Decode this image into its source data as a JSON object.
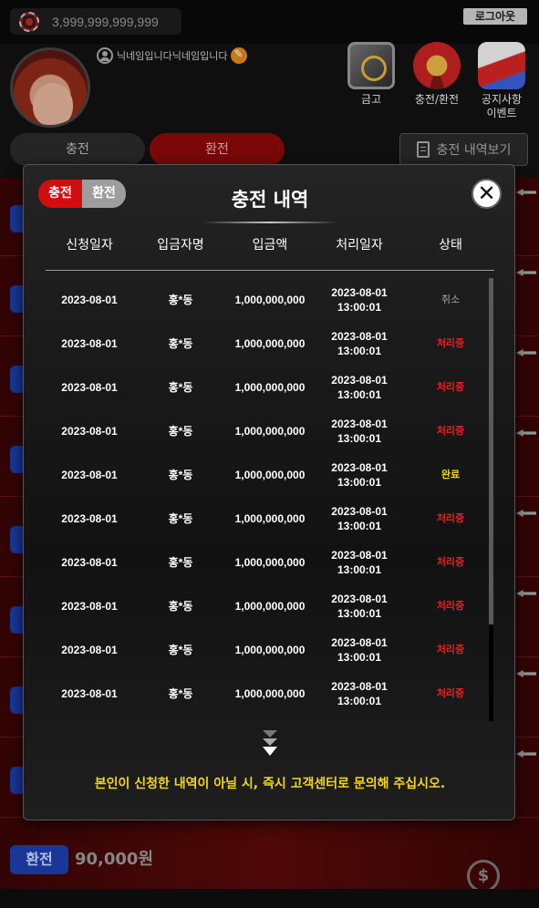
{
  "header": {
    "balance": "3,999,999,999,999",
    "logout_label": "로그아웃",
    "nickname": "닉네임입니다닉네임입니다"
  },
  "menu": {
    "vault_label": "금고",
    "exchange_label": "충전/환전",
    "notice_label_line1": "공지사항",
    "notice_label_line2": "이벤트"
  },
  "tabs": {
    "charge_label": "충전",
    "exchange_label": "환전",
    "history_label": "충전 내역보기"
  },
  "background_list": {
    "last_badge": "환전",
    "last_amount": "90,000원"
  },
  "modal": {
    "title": "충전 내역",
    "tab_charge": "충전",
    "tab_exchange": "환전",
    "close_icon": "close-icon",
    "columns": [
      "신청일자",
      "입금자명",
      "입금액",
      "처리일자",
      "상태"
    ],
    "rows": [
      {
        "date": "2023-08-01",
        "depositor": "홍*동",
        "amount": "1,000,000,000",
        "processed_date": "2023-08-01",
        "processed_time": "13:00:01",
        "status": "취소",
        "status_type": "cancel"
      },
      {
        "date": "2023-08-01",
        "depositor": "홍*동",
        "amount": "1,000,000,000",
        "processed_date": "2023-08-01",
        "processed_time": "13:00:01",
        "status": "처리중",
        "status_type": "processing"
      },
      {
        "date": "2023-08-01",
        "depositor": "홍*동",
        "amount": "1,000,000,000",
        "processed_date": "2023-08-01",
        "processed_time": "13:00:01",
        "status": "처리중",
        "status_type": "processing"
      },
      {
        "date": "2023-08-01",
        "depositor": "홍*동",
        "amount": "1,000,000,000",
        "processed_date": "2023-08-01",
        "processed_time": "13:00:01",
        "status": "처리중",
        "status_type": "processing"
      },
      {
        "date": "2023-08-01",
        "depositor": "홍*동",
        "amount": "1,000,000,000",
        "processed_date": "2023-08-01",
        "processed_time": "13:00:01",
        "status": "완료",
        "status_type": "done"
      },
      {
        "date": "2023-08-01",
        "depositor": "홍*동",
        "amount": "1,000,000,000",
        "processed_date": "2023-08-01",
        "processed_time": "13:00:01",
        "status": "처리중",
        "status_type": "processing"
      },
      {
        "date": "2023-08-01",
        "depositor": "홍*동",
        "amount": "1,000,000,000",
        "processed_date": "2023-08-01",
        "processed_time": "13:00:01",
        "status": "처리중",
        "status_type": "processing"
      },
      {
        "date": "2023-08-01",
        "depositor": "홍*동",
        "amount": "1,000,000,000",
        "processed_date": "2023-08-01",
        "processed_time": "13:00:01",
        "status": "처리중",
        "status_type": "processing"
      },
      {
        "date": "2023-08-01",
        "depositor": "홍*동",
        "amount": "1,000,000,000",
        "processed_date": "2023-08-01",
        "processed_time": "13:00:01",
        "status": "처리중",
        "status_type": "processing"
      },
      {
        "date": "2023-08-01",
        "depositor": "홍*동",
        "amount": "1,000,000,000",
        "processed_date": "2023-08-01",
        "processed_time": "13:00:01",
        "status": "처리중",
        "status_type": "processing"
      }
    ],
    "notice": "본인이 신청한 내역이 아닐 시, 즉시 고객센터로 문의해 주십시오."
  },
  "colors": {
    "active_tab": "#d20d0d",
    "processing": "#ee1f1f",
    "done": "#f2d51a",
    "cancel": "#a8a8a8",
    "notice": "#f2d51a"
  }
}
